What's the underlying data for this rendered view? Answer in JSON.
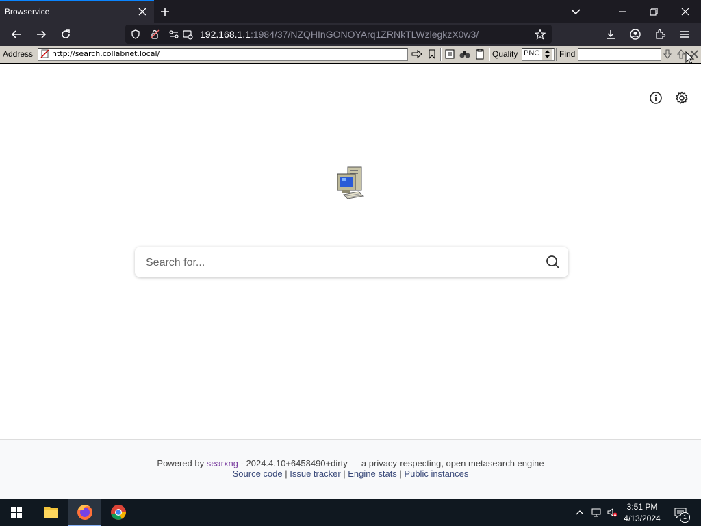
{
  "browser": {
    "tab_title": "Browservice",
    "url_host": "192.168.1.1",
    "url_path": ":1984/37/NZQHInGONOYArq1ZRNkTLWzlegkzX0w3/"
  },
  "toolbar": {
    "address_label": "Address",
    "address_value": "http://search.collabnet.local/",
    "quality_label": "Quality",
    "quality_value": "PNG",
    "find_label": "Find",
    "find_value": ""
  },
  "page": {
    "search_placeholder": "Search for...",
    "footer_powered": "Powered by",
    "footer_brand": "searxng",
    "footer_version": " - 2024.4.10+6458490+dirty — a privacy-respecting, open metasearch engine",
    "links": [
      "Source code",
      "Issue tracker",
      "Engine stats",
      "Public instances"
    ],
    "link_separator": " | "
  },
  "taskbar": {
    "time": "3:51 PM",
    "date": "4/13/2024",
    "notification_count": "1"
  },
  "colors": {
    "firefox_bg": "#2b2a33",
    "tab_accent": "#0a84ff",
    "brand_link": "#7b3fa0",
    "taskbar": "#101820"
  }
}
